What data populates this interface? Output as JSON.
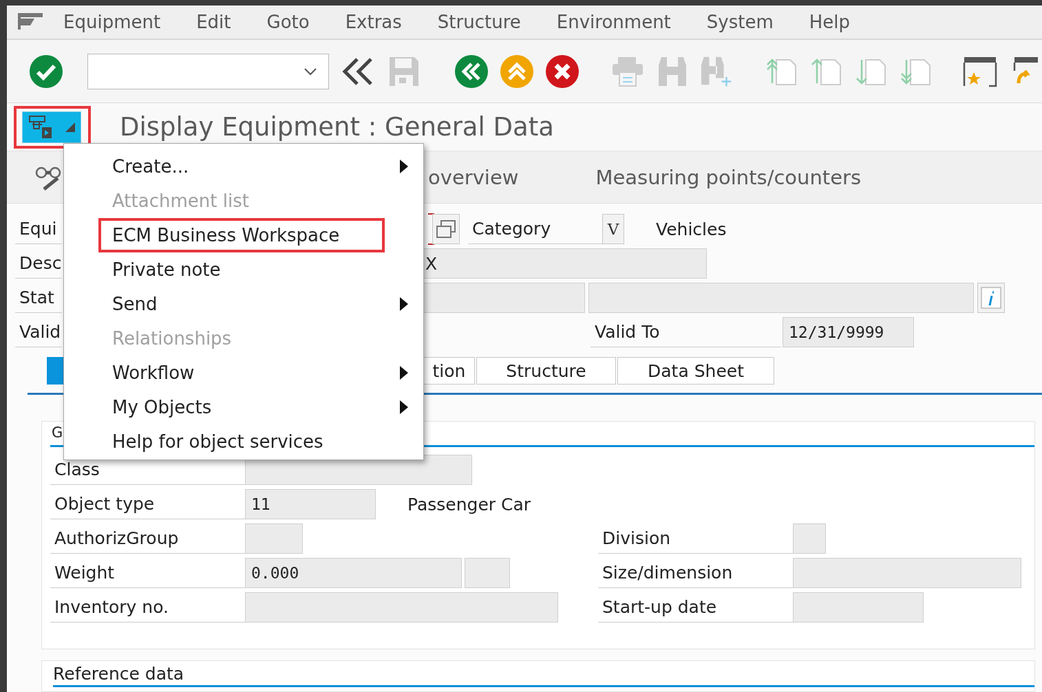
{
  "menu_bar": [
    "Equipment",
    "Edit",
    "Goto",
    "Extras",
    "Structure",
    "Environment",
    "System",
    "Help"
  ],
  "title": "Display Equipment : General Data",
  "services_button": {
    "highlighted": true
  },
  "app_toolbar": [
    "overview",
    "Measuring points/counters"
  ],
  "header": {
    "equipment_label": "Equi",
    "category_label": "Category",
    "category_button": "V",
    "category_value": "Vehicles",
    "description_label": "Desc",
    "description_value": "X",
    "status_label": "Stat",
    "valid_label": "Valid",
    "valid_to_label": "Valid To",
    "valid_to_value": "12/31/9999"
  },
  "tabs": [
    {
      "selected": true
    },
    {
      "label": "tion",
      "selected": false
    },
    {
      "label": "Structure",
      "selected": false
    },
    {
      "label": "Data Sheet",
      "selected": false
    }
  ],
  "group": {
    "title": "G",
    "rows": [
      {
        "label": "Class"
      },
      {
        "label": "Object type",
        "value": "11",
        "note": "Passenger Car"
      },
      {
        "label": "AuthorizGroup"
      },
      {
        "label": "Weight",
        "value": "0.000"
      },
      {
        "label": "Inventory no."
      }
    ],
    "right_rows": [
      {
        "label": "Division"
      },
      {
        "label": "Size/dimension"
      },
      {
        "label": "Start-up date"
      }
    ]
  },
  "reference": {
    "title": "Reference data"
  },
  "context_menu": [
    {
      "label": "Create...",
      "disabled": false,
      "submenu": true,
      "highlighted": false
    },
    {
      "label": "Attachment list",
      "disabled": true,
      "submenu": false,
      "highlighted": false
    },
    {
      "label": "ECM Business Workspace",
      "disabled": false,
      "submenu": false,
      "highlighted": true
    },
    {
      "label": "Private note",
      "disabled": false,
      "submenu": false,
      "highlighted": false
    },
    {
      "label": "Send",
      "disabled": false,
      "submenu": true,
      "highlighted": false
    },
    {
      "label": "Relationships",
      "disabled": true,
      "submenu": false,
      "highlighted": false
    },
    {
      "label": "Workflow",
      "disabled": false,
      "submenu": true,
      "highlighted": false
    },
    {
      "label": "My Objects",
      "disabled": false,
      "submenu": true,
      "highlighted": false
    },
    {
      "label": "Help for object services",
      "disabled": false,
      "submenu": false,
      "highlighted": false
    }
  ]
}
